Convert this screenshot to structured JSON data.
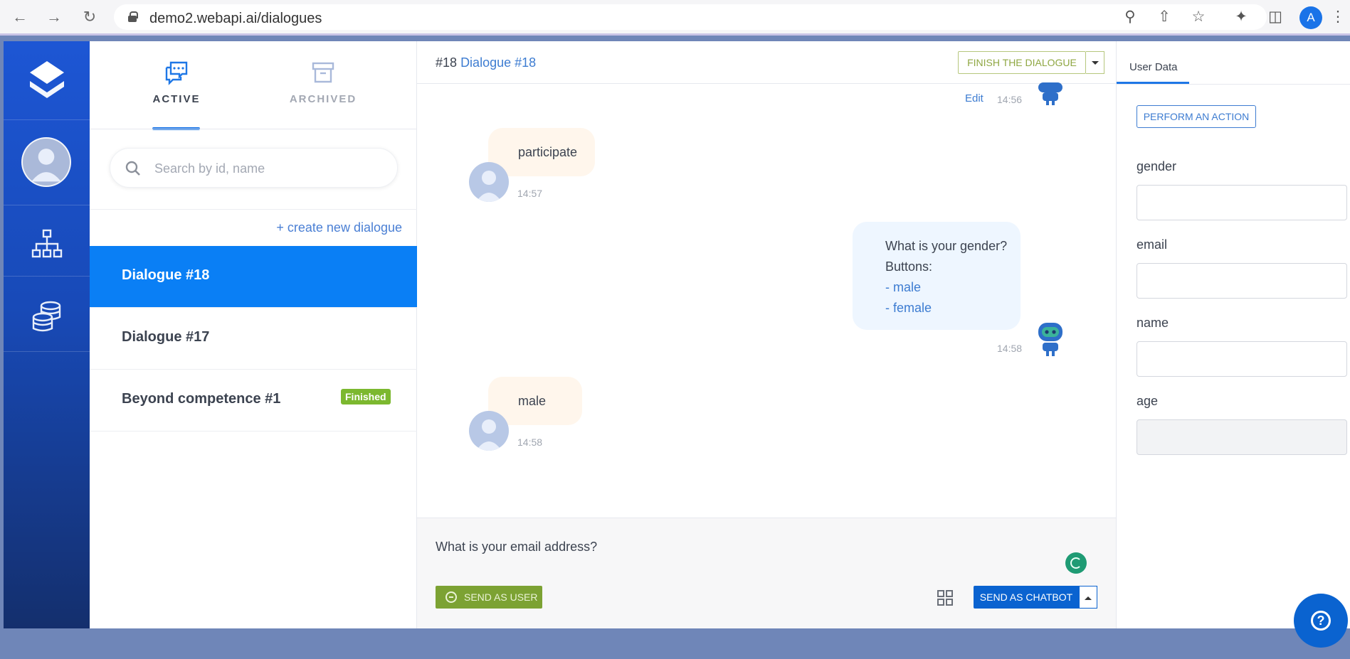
{
  "browser": {
    "url": "demo2.webapi.ai/dialogues",
    "profile_initial": "A",
    "icons": [
      "back-arrow-icon",
      "forward-arrow-icon",
      "reload-icon",
      "lock-icon",
      "zoom-icon",
      "share-icon",
      "star-icon",
      "extensions-icon",
      "sidepanel-icon",
      "menu-icon"
    ]
  },
  "tabs": [
    {
      "label": "ACTIVE",
      "icon": "chat-bubbles-icon",
      "active": true
    },
    {
      "label": "ARCHIVED",
      "icon": "archive-box-icon",
      "active": false
    }
  ],
  "search": {
    "placeholder": "Search by id, name"
  },
  "create_link": "+ create new dialogue",
  "dialogues": [
    {
      "name": "Dialogue #18",
      "active": true
    },
    {
      "name": "Dialogue #17",
      "active": false
    },
    {
      "name": "Beyond competence #1",
      "active": false,
      "badge": "Finished"
    }
  ],
  "chat": {
    "title_num": "#18",
    "title_name": "Dialogue #18",
    "finish_label": "FINISH THE DIALOGUE",
    "messages": [
      {
        "from": "bot",
        "edit": "Edit",
        "time": "14:56"
      },
      {
        "from": "user",
        "text": "participate",
        "time": "14:57"
      },
      {
        "from": "bot",
        "lines": [
          "What is your gender?",
          "Buttons:"
        ],
        "options": [
          "- male",
          "- female"
        ],
        "time": "14:58"
      },
      {
        "from": "user",
        "text": "male",
        "time": "14:58"
      }
    ],
    "composer_text": "What is your email address?",
    "send_user_label": "SEND AS USER",
    "send_bot_label": "SEND AS CHATBOT"
  },
  "user_data": {
    "tab": "User Data",
    "perform_label": "PERFORM AN ACTION",
    "fields": [
      {
        "label": "gender",
        "value": ""
      },
      {
        "label": "email",
        "value": ""
      },
      {
        "label": "name",
        "value": ""
      },
      {
        "label": "age",
        "value": "",
        "disabled": true
      }
    ]
  },
  "colors": {
    "rail": "#1d56d4",
    "active_item": "#0a7ff5",
    "accent": "#3d7cd1",
    "send_user": "#7ca233",
    "send_bot": "#0a63d0",
    "finished_badge": "#7cb82f"
  }
}
